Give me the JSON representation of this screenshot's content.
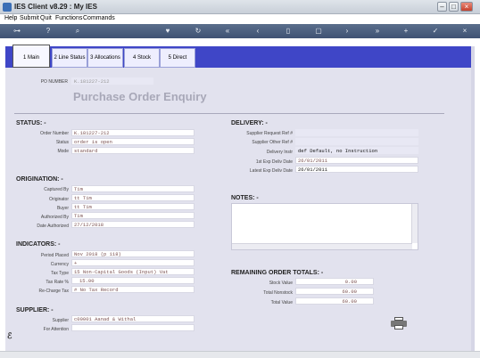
{
  "window": {
    "title": "IES Client v8.29 : My IES"
  },
  "menu": [
    "Help",
    "Submit",
    "Quit",
    "Functions",
    "Commands"
  ],
  "tabs": [
    {
      "label": "1 Main"
    },
    {
      "label": "2 Line Status"
    },
    {
      "label": "3 Allocations"
    },
    {
      "label": "4 Stock"
    },
    {
      "label": "5 Direct"
    }
  ],
  "header": {
    "po_label": "PO NUMBER",
    "po_value": "K.181227-212",
    "title": "Purchase Order Enquiry"
  },
  "status": {
    "heading": "STATUS: -",
    "order_number_label": "Order Number",
    "order_number": "K.181227-212",
    "status_label": "Status",
    "status": "order is open",
    "mode_label": "Mode",
    "mode": "standard"
  },
  "origination": {
    "heading": "ORIGINATION: -",
    "captured_by_label": "Captured By",
    "captured_by": "Tim",
    "originator_label": "Originator",
    "originator": "tt Tim",
    "buyer_label": "Buyer",
    "buyer": "tt Tim",
    "authorized_by_label": "Authorized By",
    "authorized_by": "Tim",
    "date_authorized_label": "Date Authorized",
    "date_authorized": "27/12/2018"
  },
  "indicators": {
    "heading": "INDICATORS: -",
    "period_label": "Period Placed",
    "period": "Nov 2018 (p 118)",
    "currency_label": "Currency",
    "currency": "+",
    "tax_type_label": "Tax Type",
    "tax_type": "15 Non-Capital Goods (Input) Vat",
    "tax_rate_label": "Tax Rate  %",
    "tax_rate": "15.00",
    "recharge_label": "Re-Charge Tax",
    "recharge": "# No Tax Record"
  },
  "supplier": {
    "heading": "SUPPLIER: -",
    "supplier_label": "Supplier",
    "supplier": "c00001 Aanad & Withal",
    "attention_label": "For Attention",
    "attention": ""
  },
  "delivery": {
    "heading": "DELIVERY: -",
    "req_ref_label": "Supplier Request Ref #",
    "req_ref": "",
    "other_ref_label": "Supplier Other Ref #",
    "other_ref": "",
    "instr_label": "Delivery Instr",
    "instr": "def Default, no Instruction",
    "first_date_label": "1st Exp Deliv Date",
    "first_date": "26/01/2011",
    "latest_date_label": "Latest Exp Deliv Date",
    "latest_date": "26/01/2011"
  },
  "notes": {
    "heading": "NOTES: -"
  },
  "totals": {
    "heading": "REMAINING ORDER TOTALS: -",
    "stock_label": "Stock Value",
    "stock": "0.00",
    "nonstock_label": "Total Nonstock",
    "nonstock": "60.00",
    "total_label": "Total Value",
    "total": "60.00"
  }
}
